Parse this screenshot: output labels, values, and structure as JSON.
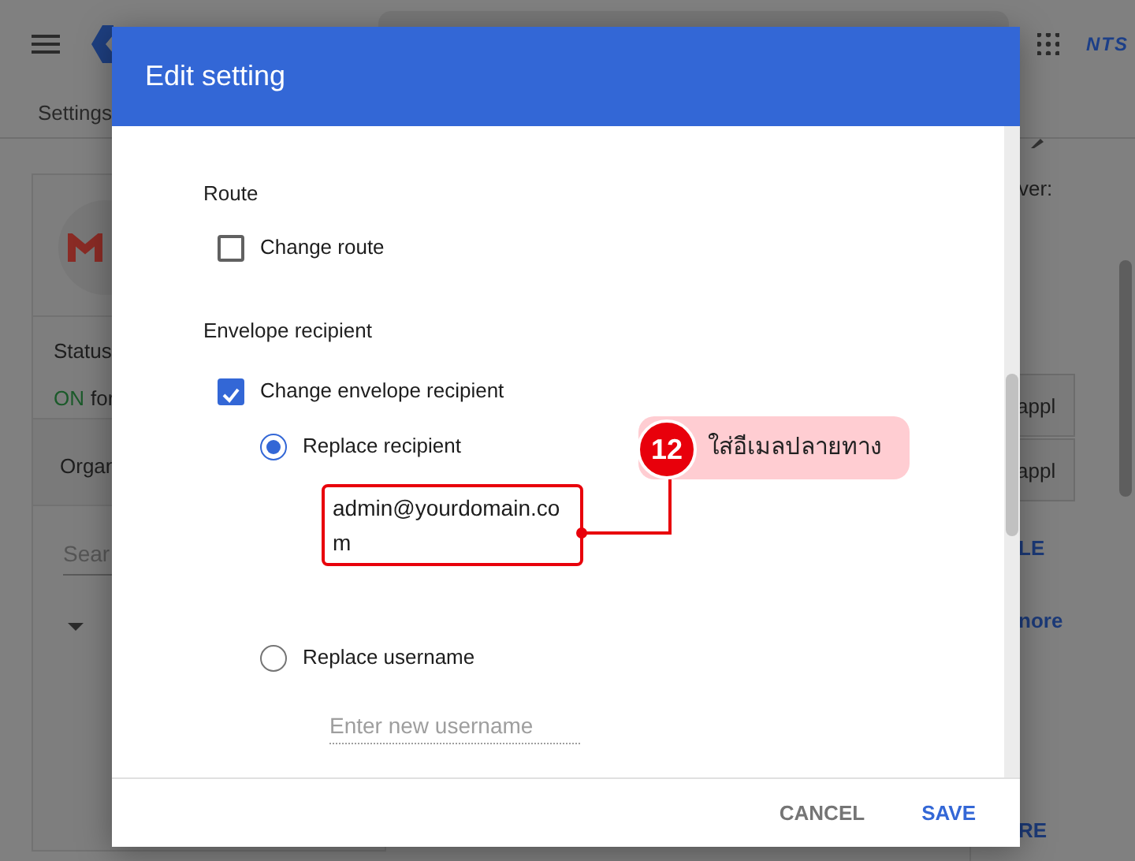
{
  "background": {
    "logo_text": "NTS",
    "breadcrumb": "Settings",
    "left_card": {
      "status_label": "Status",
      "status_value": "ON",
      "status_suffix": "for",
      "org_label": "Organ",
      "search_placeholder": "Sear"
    },
    "right_fragments": [
      {
        "kind": "text",
        "text": "ver:"
      },
      {
        "kind": "cell",
        "text": "appl"
      },
      {
        "kind": "cell",
        "text": "appl"
      },
      {
        "kind": "link",
        "text": "LE"
      },
      {
        "kind": "link",
        "text": "nore"
      },
      {
        "kind": "link",
        "text": "RE"
      }
    ]
  },
  "dialog": {
    "title": "Edit setting",
    "sections": [
      {
        "heading": "Route",
        "options": [
          {
            "kind": "checkbox",
            "label": "Change route",
            "checked": false
          }
        ]
      },
      {
        "heading": "Envelope recipient",
        "options": [
          {
            "kind": "checkbox",
            "label": "Change envelope recipient",
            "checked": true
          },
          {
            "kind": "radio",
            "label": "Replace recipient",
            "selected": true,
            "value": "admin@yourdomain.com",
            "highlighted": true
          },
          {
            "kind": "radio",
            "label": "Replace username",
            "selected": false,
            "placeholder": "Enter new username",
            "highlighted": false
          }
        ]
      }
    ],
    "buttons": [
      {
        "kind": "secondary",
        "label": "CANCEL"
      },
      {
        "kind": "primary",
        "label": "SAVE"
      }
    ]
  },
  "annotation": {
    "number": "12",
    "text": "ใส่อีเมลปลายทาง"
  }
}
